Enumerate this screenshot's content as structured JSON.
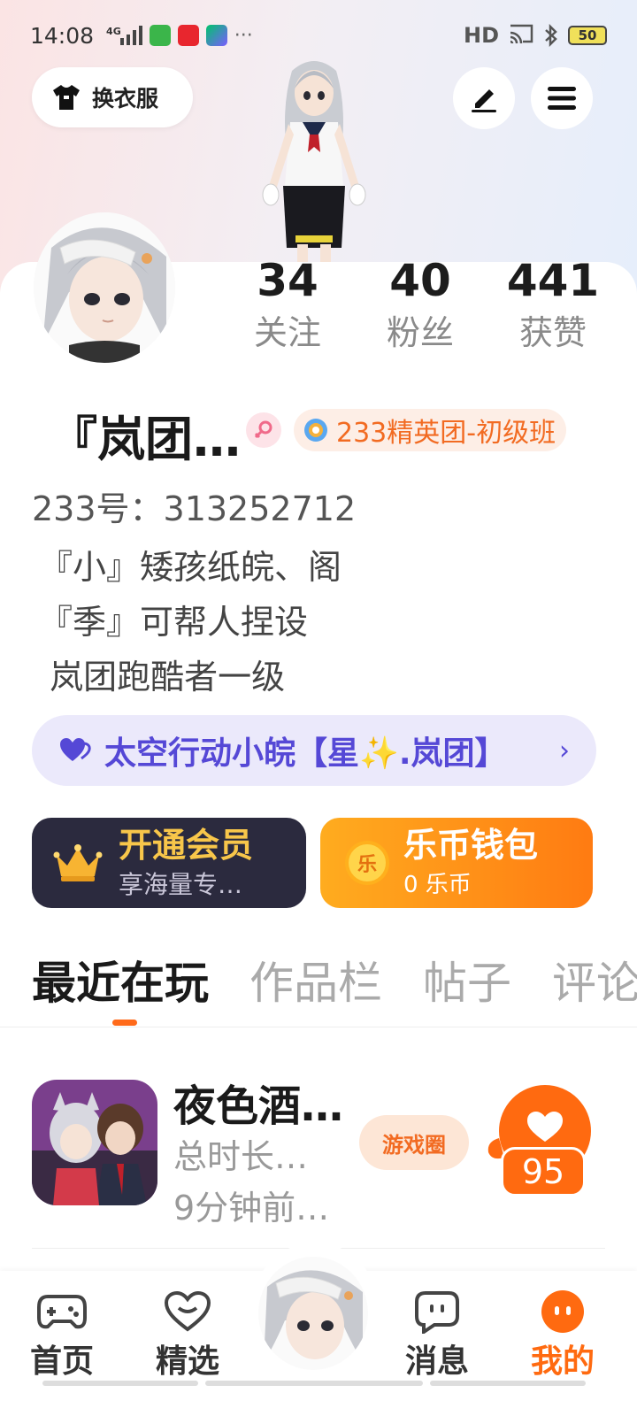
{
  "status_bar": {
    "time": "14:08",
    "network": "4G",
    "hd_label": "HD",
    "battery": "50"
  },
  "header": {
    "wardrobe_label": "换衣服"
  },
  "profile": {
    "stats": [
      {
        "value": "34",
        "label": "关注"
      },
      {
        "value": "40",
        "label": "粉丝"
      },
      {
        "value": "441",
        "label": "获赞"
      }
    ],
    "name": "『岚团…",
    "level_badge": "233精英团-初级班",
    "uid": "233号：313252712",
    "bio_lines": [
      "『小』矮孩纸皖、阁",
      "『季』可帮人捏设",
      " 岚团跑酷者一级"
    ],
    "group_name": "太空行动小皖【星✨.岚团】"
  },
  "promo": {
    "vip_title": "开通会员",
    "vip_sub": "享海量专…",
    "wallet_title": "乐币钱包",
    "wallet_sub": "0 乐币",
    "coin_glyph": "乐"
  },
  "tabs": [
    "最近在玩",
    "作品栏",
    "帖子",
    "评论"
  ],
  "recent": [
    {
      "title": "夜色酒…",
      "duration": "总时长…",
      "last_played": "9分钟前…",
      "circle_label": "游戏圈",
      "likes": "95"
    }
  ],
  "bottom_nav": [
    {
      "label": "首页"
    },
    {
      "label": "精选"
    },
    {
      "label": "消息"
    },
    {
      "label": "我的"
    }
  ],
  "colors": {
    "accent": "#ff6a10",
    "group_text": "#5548d6",
    "vip_gold": "#f8c64a"
  }
}
